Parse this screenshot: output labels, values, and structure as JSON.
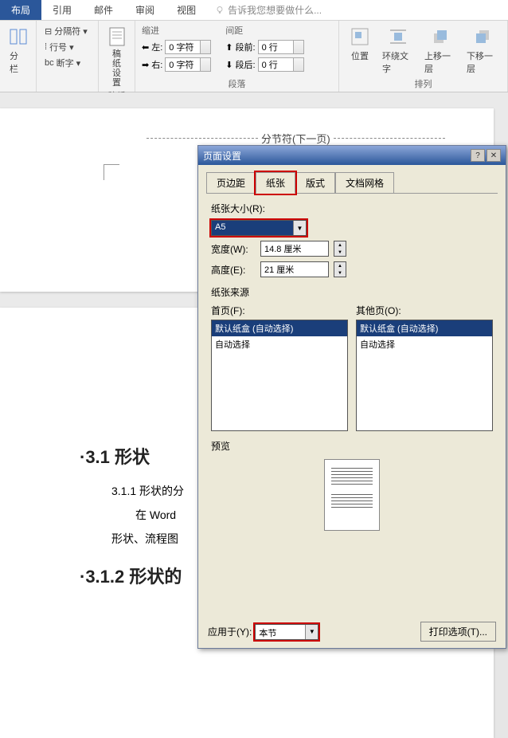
{
  "ribbon": {
    "tabs": [
      "布局",
      "引用",
      "邮件",
      "审阅",
      "视图"
    ],
    "tell_me": "告诉我您想要做什么...",
    "columns": {
      "label": "分栏"
    },
    "breaks": {
      "separator": "分隔符",
      "line_num": "行号",
      "hyphen": "断字"
    },
    "paper_settings": {
      "button": "稿纸\n设置",
      "group": "稿纸"
    },
    "indent": {
      "group_label": "缩进",
      "left_label": "左:",
      "left_val": "0 字符",
      "right_label": "右:",
      "right_val": "0 字符"
    },
    "spacing": {
      "group_label": "间距",
      "before_label": "段前:",
      "before_val": "0 行",
      "after_label": "段后:",
      "after_val": "0 行"
    },
    "paragraph_group": "段落",
    "arrange": {
      "position": "位置",
      "wrap": "环绕文字",
      "forward": "上移一层",
      "backward": "下移一层",
      "group": "排列"
    }
  },
  "document": {
    "section_break": "分节符(下一页)",
    "heading1": "·3.1 形状",
    "line1": "3.1.1 形状的分",
    "line2": "在 Word",
    "line3": "形状、流程图",
    "heading2": "·3.1.2 形状的"
  },
  "dialog": {
    "title": "页面设置",
    "tabs": [
      "页边距",
      "纸张",
      "版式",
      "文档网格"
    ],
    "paper_size_label": "纸张大小(R):",
    "paper_size_val": "A5",
    "width_label": "宽度(W):",
    "width_val": "14.8 厘米",
    "height_label": "高度(E):",
    "height_val": "21 厘米",
    "source_label": "纸张来源",
    "first_page_label": "首页(F):",
    "other_pages_label": "其他页(O):",
    "tray_default": "默认纸盒 (自动选择)",
    "tray_auto": "自动选择",
    "preview_label": "预览",
    "apply_to_label": "应用于(Y):",
    "apply_to_val": "本节",
    "print_options": "打印选项(T)..."
  }
}
